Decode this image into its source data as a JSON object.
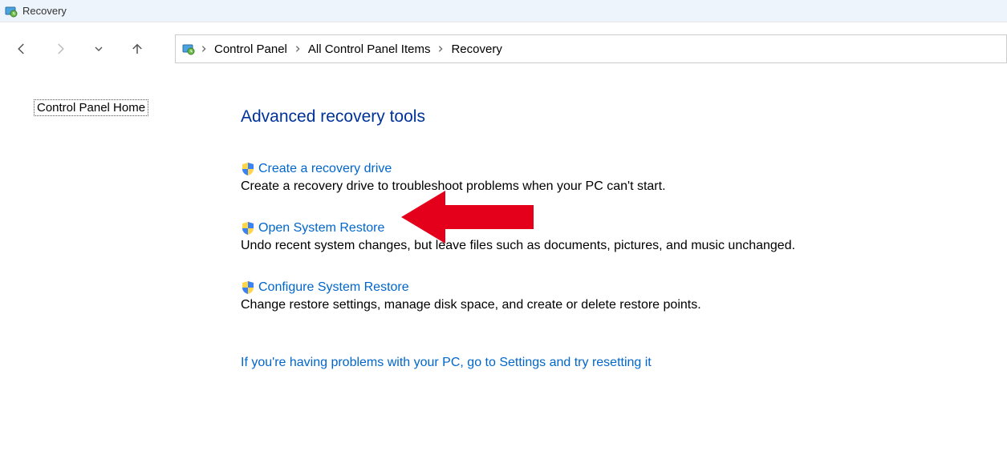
{
  "window": {
    "title": "Recovery"
  },
  "breadcrumb": {
    "items": [
      "Control Panel",
      "All Control Panel Items",
      "Recovery"
    ]
  },
  "sidebar": {
    "home": "Control Panel Home"
  },
  "main": {
    "heading": "Advanced recovery tools",
    "options": [
      {
        "link": "Create a recovery drive",
        "desc": "Create a recovery drive to troubleshoot problems when your PC can't start."
      },
      {
        "link": "Open System Restore",
        "desc": "Undo recent system changes, but leave files such as documents, pictures, and music unchanged."
      },
      {
        "link": "Configure System Restore",
        "desc": "Change restore settings, manage disk space, and create or delete restore points."
      }
    ],
    "extra_link": "If you're having problems with your PC, go to Settings and try resetting it"
  }
}
